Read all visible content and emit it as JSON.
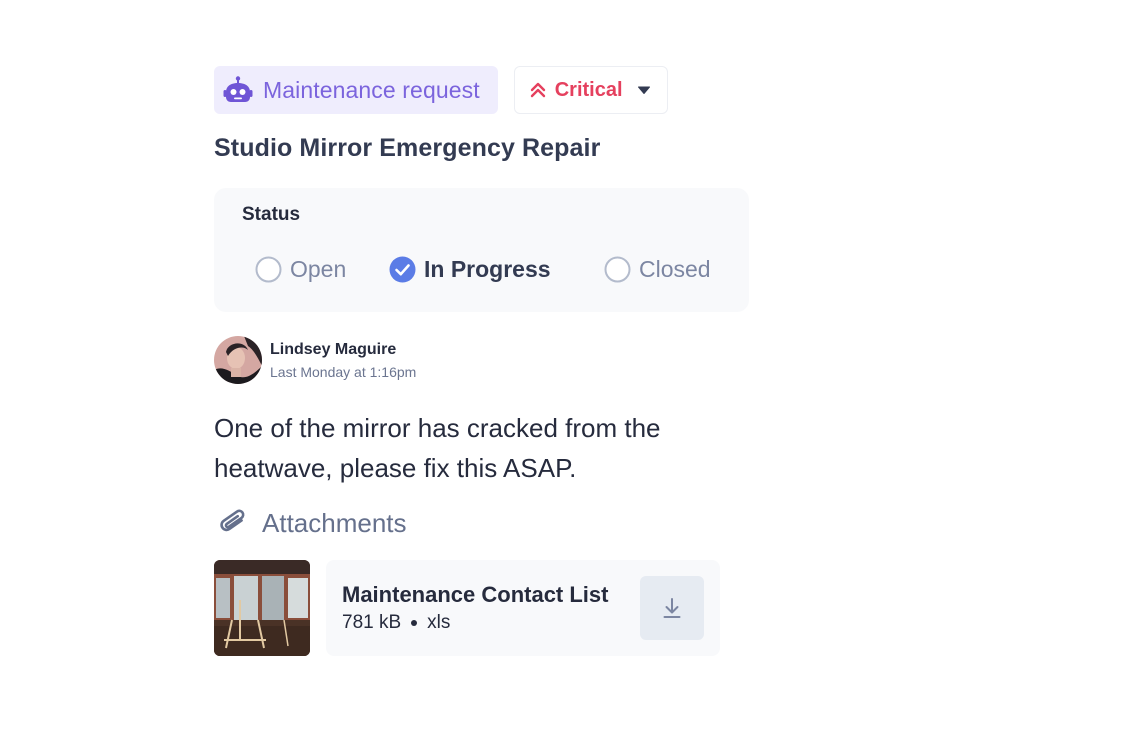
{
  "request": {
    "type_label": "Maintenance request",
    "type_icon": "robot-icon",
    "priority": {
      "label": "Critical",
      "icon": "double-chevron-up-icon",
      "color": "#e5405e"
    },
    "title": "Studio Mirror Emergency Repair"
  },
  "status": {
    "heading": "Status",
    "options": [
      {
        "label": "Open",
        "selected": false
      },
      {
        "label": "In Progress",
        "selected": true
      },
      {
        "label": "Closed",
        "selected": false
      }
    ],
    "accent_color": "#5b7ce6"
  },
  "author": {
    "name": "Lindsey Maguire",
    "timestamp": "Last Monday at 1:16pm"
  },
  "message": "One of the mirror has cracked from the heatwave, please fix this ASAP.",
  "attachments": {
    "label": "Attachments",
    "icon": "paperclip-icon",
    "file": {
      "name": "Maintenance Contact List",
      "size": "781 kB",
      "extension": "xls",
      "action_icon": "download-icon"
    }
  }
}
